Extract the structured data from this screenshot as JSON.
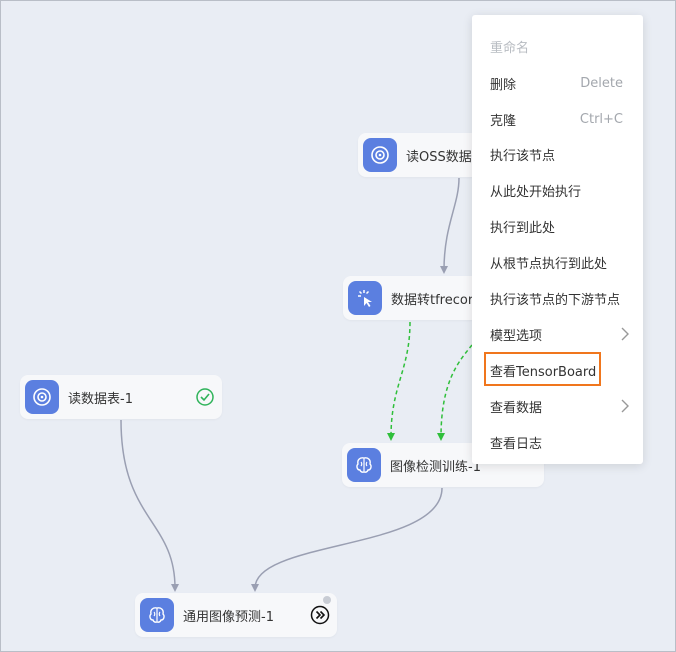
{
  "nodes": {
    "read_oss": {
      "label": "读OSS数据",
      "icon": "target-icon"
    },
    "tfrecord": {
      "label": "数据转tfrecor",
      "icon": "cursor-click-icon"
    },
    "read_table": {
      "label": "读数据表-1",
      "icon": "target-icon",
      "status": "success"
    },
    "detection": {
      "label": "图像检测训练-1",
      "icon": "brain-icon"
    },
    "predict": {
      "label": "通用图像预测-1",
      "icon": "brain-icon"
    }
  },
  "context_menu": {
    "items": [
      {
        "label": "重命名",
        "disabled": true
      },
      {
        "label": "删除",
        "shortcut": "Delete"
      },
      {
        "label": "克隆",
        "shortcut": "Ctrl+C"
      },
      {
        "label": "执行该节点"
      },
      {
        "label": "从此处开始执行"
      },
      {
        "label": "执行到此处"
      },
      {
        "label": "从根节点执行到此处"
      },
      {
        "label": "执行该节点的下游节点"
      },
      {
        "label": "模型选项",
        "submenu": true
      },
      {
        "label": "查看TensorBoard",
        "highlighted": true
      },
      {
        "label": "查看数据",
        "submenu": true
      },
      {
        "label": "查看日志"
      }
    ]
  },
  "colors": {
    "canvas": "#e9edf4",
    "node_icon": "#5b7fe0",
    "edge": "#9a9fb2",
    "pending_edge": "#2fbf3a",
    "highlight": "#f0761d",
    "success": "#2fb35a"
  }
}
